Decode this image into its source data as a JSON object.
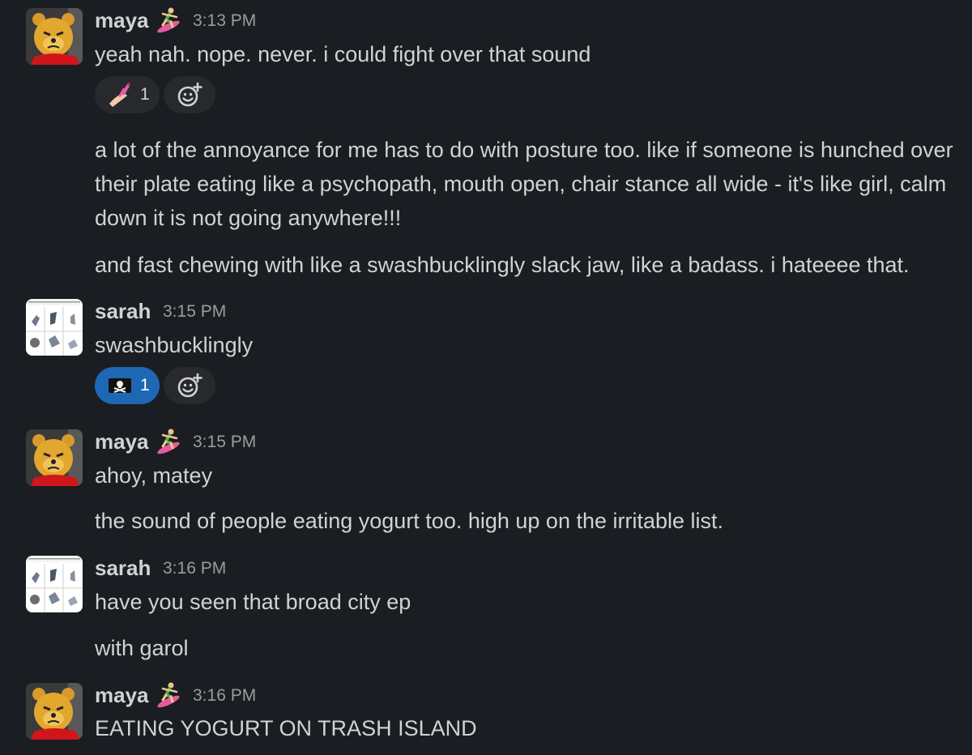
{
  "messages": [
    {
      "author": "maya",
      "time": "3:13 PM",
      "lines": [
        "yeah nah. nope. never. i could fight over that sound"
      ],
      "reaction": {
        "emoji": "nail-polish-emoji",
        "count": "1"
      }
    },
    {
      "author": "maya",
      "lines": [
        "a lot of the annoyance for me has to do with posture too. like if someone is hunched over their plate eating like a psychopath, mouth open, chair stance all wide - it's like girl, calm down it is not going anywhere!!!",
        "and fast chewing with like a swashbucklingly slack jaw, like a badass. i hateeee that."
      ]
    },
    {
      "author": "sarah",
      "time": "3:15 PM",
      "lines": [
        "swashbucklingly"
      ],
      "reaction": {
        "emoji": "pirate-flag-emoji",
        "count": "1"
      }
    },
    {
      "author": "maya",
      "time": "3:15 PM",
      "lines": [
        "ahoy, matey",
        "the sound of people eating yogurt too. high up on the irritable list."
      ]
    },
    {
      "author": "sarah",
      "time": "3:16 PM",
      "lines": [
        "have you seen that broad city ep",
        "with garol"
      ]
    },
    {
      "author": "maya",
      "time": "3:16 PM",
      "lines": [
        "EATING YOGURT ON TRASH ISLAND"
      ]
    }
  ],
  "icons": {
    "maya_avatar": "winnie-the-pooh-avatar",
    "sarah_avatar": "captcha-grid-avatar",
    "status": "surfer-emoji",
    "add_reaction": "add-reaction-icon"
  },
  "colors": {
    "background": "#1a1d21",
    "text": "#d1d2d3",
    "muted": "#9b9c9e",
    "reaction_bg": "#27292d",
    "reaction_active": "#1d67b5"
  }
}
